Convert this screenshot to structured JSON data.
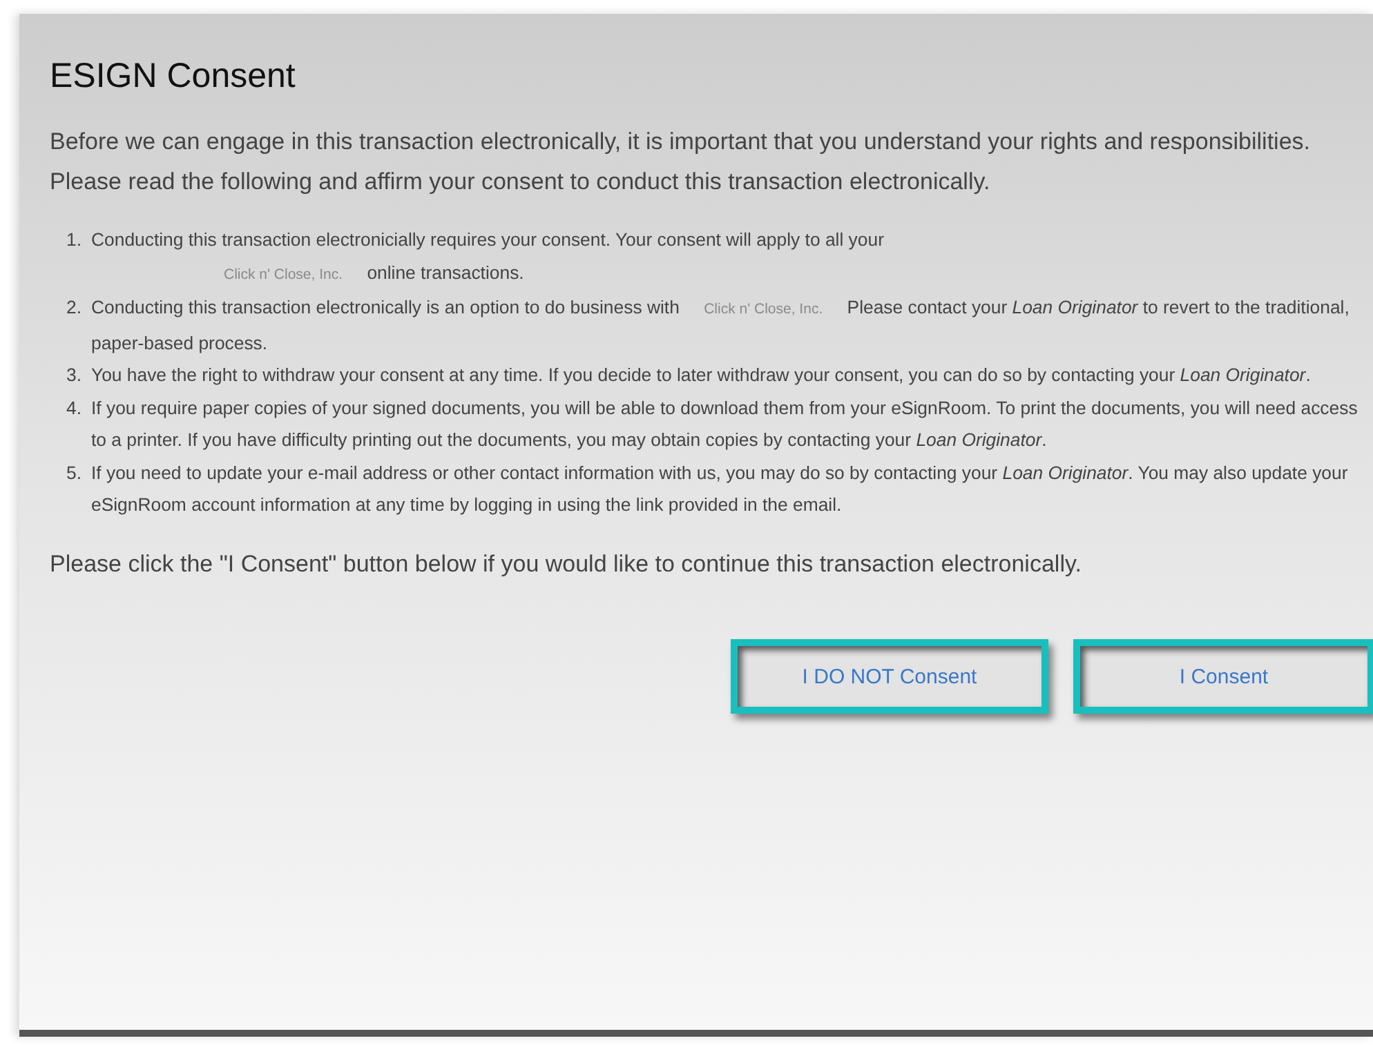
{
  "dialog": {
    "title": "ESIGN Consent",
    "intro": "Before we can engage in this transaction electronically, it is important that you understand your rights and responsibilities. Please read the following and affirm your consent to conduct this transaction electronically.",
    "items": [
      {
        "number": "1.",
        "parts": [
          {
            "kind": "text",
            "text": "Conducting this transaction electronicially requires your consent. Your consent will apply to all your"
          },
          {
            "kind": "company",
            "newline": true,
            "text": "Click n' Close, Inc."
          },
          {
            "kind": "text",
            "text": "online transactions."
          }
        ]
      },
      {
        "number": "2.",
        "parts": [
          {
            "kind": "text",
            "text": "Conducting this transaction electronically is an option to do business with"
          },
          {
            "kind": "company",
            "newline": false,
            "text": "Click n' Close, Inc."
          },
          {
            "kind": "text",
            "text": "Please contact your *Loan Originator* to revert to the traditional, paper-based process."
          }
        ]
      },
      {
        "number": "3.",
        "parts": [
          {
            "kind": "text",
            "text": "You have the right to withdraw your consent at any time. If you decide to later withdraw your consent, you can do so by contacting your *Loan Originator*."
          }
        ]
      },
      {
        "number": "4.",
        "parts": [
          {
            "kind": "text",
            "text": "If you require paper copies of your signed documents, you will be able to download them from your eSignRoom. To print the documents, you will need access to a printer. If you have difficulty printing out the documents, you may obtain copies by contacting your *Loan Originator*."
          }
        ]
      },
      {
        "number": "5.",
        "parts": [
          {
            "kind": "text",
            "text": "If you need to update your e-mail address or other contact information with us, you may do so by contacting your *Loan Originator*. You may also update your eSignRoom account information at any time by logging in using the link provided in the email."
          }
        ]
      }
    ],
    "closing": "Please click the \"I Consent\" button below if you would like to continue this transaction electronically.",
    "buttons": [
      {
        "label": "I DO NOT Consent"
      },
      {
        "label": "I Consent"
      }
    ]
  }
}
